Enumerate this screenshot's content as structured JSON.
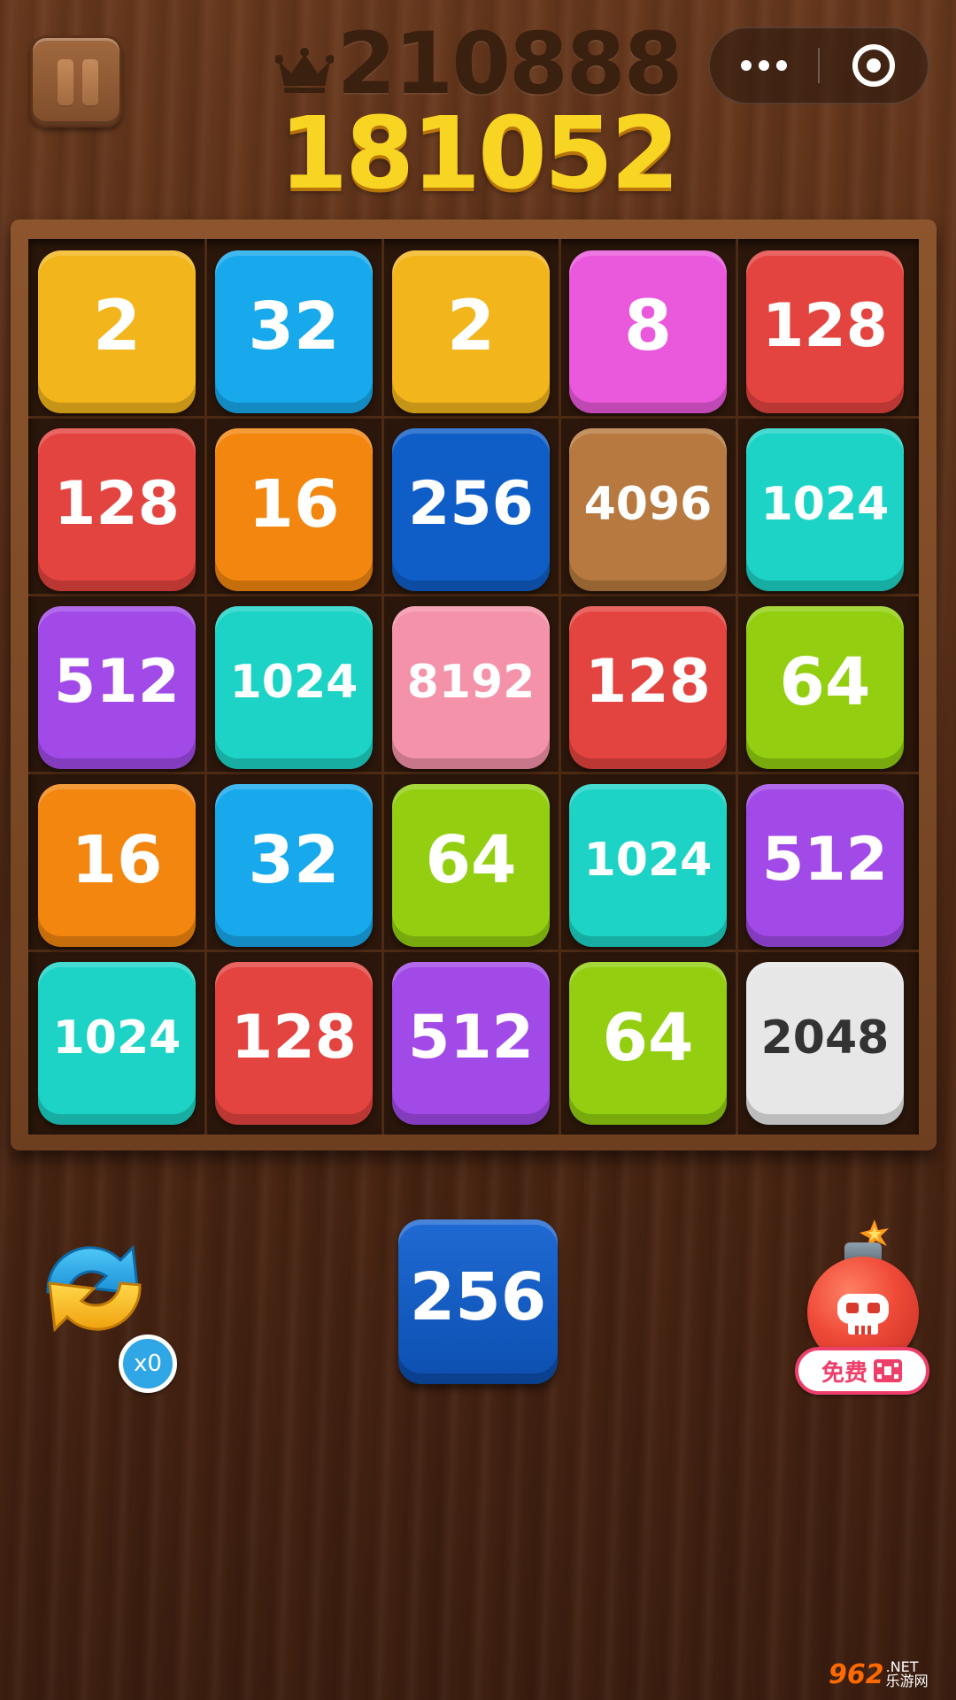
{
  "header": {
    "best_score": "210888",
    "current_score": "181052",
    "pause_icon": "pause-icon",
    "crown_icon": "crown-icon",
    "menu_icon": "more-dots-icon",
    "close_icon": "target-circle-icon"
  },
  "board": {
    "rows": [
      [
        {
          "value": "2",
          "color": "#f2b51c"
        },
        {
          "value": "32",
          "color": "#18a9ec"
        },
        {
          "value": "2",
          "color": "#f2b51c"
        },
        {
          "value": "8",
          "color": "#ea58dc"
        },
        {
          "value": "128",
          "color": "#e3443f"
        }
      ],
      [
        {
          "value": "128",
          "color": "#e3443f"
        },
        {
          "value": "16",
          "color": "#f2860f"
        },
        {
          "value": "256",
          "color": "#0f5ec7"
        },
        {
          "value": "4096",
          "color": "#b7793f"
        },
        {
          "value": "1024",
          "color": "#1dd3c6"
        }
      ],
      [
        {
          "value": "512",
          "color": "#a14ae8"
        },
        {
          "value": "1024",
          "color": "#1dd3c6"
        },
        {
          "value": "8192",
          "color": "#f392a8"
        },
        {
          "value": "128",
          "color": "#e3443f"
        },
        {
          "value": "64",
          "color": "#93cf10"
        }
      ],
      [
        {
          "value": "16",
          "color": "#f2860f"
        },
        {
          "value": "32",
          "color": "#18a9ec"
        },
        {
          "value": "64",
          "color": "#93cf10"
        },
        {
          "value": "1024",
          "color": "#1dd3c6"
        },
        {
          "value": "512",
          "color": "#a14ae8"
        }
      ],
      [
        {
          "value": "1024",
          "color": "#1dd3c6"
        },
        {
          "value": "128",
          "color": "#e3443f"
        },
        {
          "value": "512",
          "color": "#a14ae8"
        },
        {
          "value": "64",
          "color": "#93cf10"
        },
        {
          "value": "2048",
          "color": "#e7e7e7",
          "text_color": "#333333"
        }
      ]
    ]
  },
  "controls": {
    "swap_count": "x0",
    "swap_icon": "swap-arrows-icon",
    "next_tile": "256",
    "next_tile_color": "#0f5ec7",
    "bomb_icon": "skull-bomb-icon",
    "free_label": "免费",
    "video_icon": "video-ad-icon"
  },
  "watermark": {
    "logo": "962",
    "suffix": ".NET",
    "sub": "乐游网"
  }
}
